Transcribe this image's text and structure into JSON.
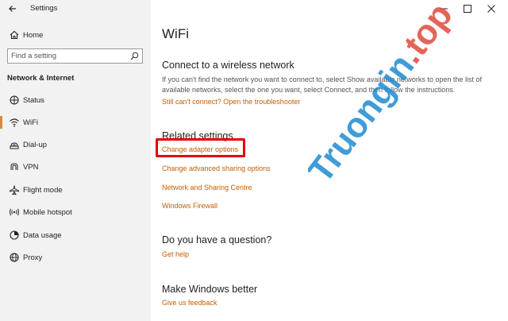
{
  "window": {
    "title": "Settings",
    "controls": [
      "minimize",
      "maximize",
      "close"
    ]
  },
  "sidebar": {
    "home_label": "Home",
    "search_placeholder": "Find a setting",
    "section_title": "Network & Internet",
    "items": [
      {
        "label": "Status",
        "icon": "status-icon"
      },
      {
        "label": "WiFi",
        "icon": "wifi-icon",
        "active": true
      },
      {
        "label": "Dial-up",
        "icon": "dialup-icon"
      },
      {
        "label": "VPN",
        "icon": "vpn-icon"
      },
      {
        "label": "Flight mode",
        "icon": "airplane-icon"
      },
      {
        "label": "Mobile hotspot",
        "icon": "hotspot-icon"
      },
      {
        "label": "Data usage",
        "icon": "data-usage-icon"
      },
      {
        "label": "Proxy",
        "icon": "globe-icon"
      }
    ]
  },
  "main": {
    "title": "WiFi",
    "connect_heading": "Connect to a wireless network",
    "connect_text": "If you can't find the network you want to connect to, select Show available networks to open the list of available networks, select the one you want, select Connect, and then follow the instructions.",
    "troubleshoot_link": "Still can't connect? Open the troubleshooter",
    "related_heading": "Related settings",
    "related_links": [
      "Change adapter options",
      "Change advanced sharing options",
      "Network and Sharing Centre",
      "Windows Firewall"
    ],
    "question_heading": "Do you have a question?",
    "help_link": "Get help",
    "better_heading": "Make Windows better",
    "feedback_link": "Give us feedback"
  },
  "watermark": {
    "text": "Truongin.top"
  },
  "colors": {
    "link": "#c45e00",
    "accent": "#d98a3a",
    "highlight": "#e8000b",
    "watermark_blue": "#1f8bd0",
    "watermark_red": "#e04a3c"
  }
}
